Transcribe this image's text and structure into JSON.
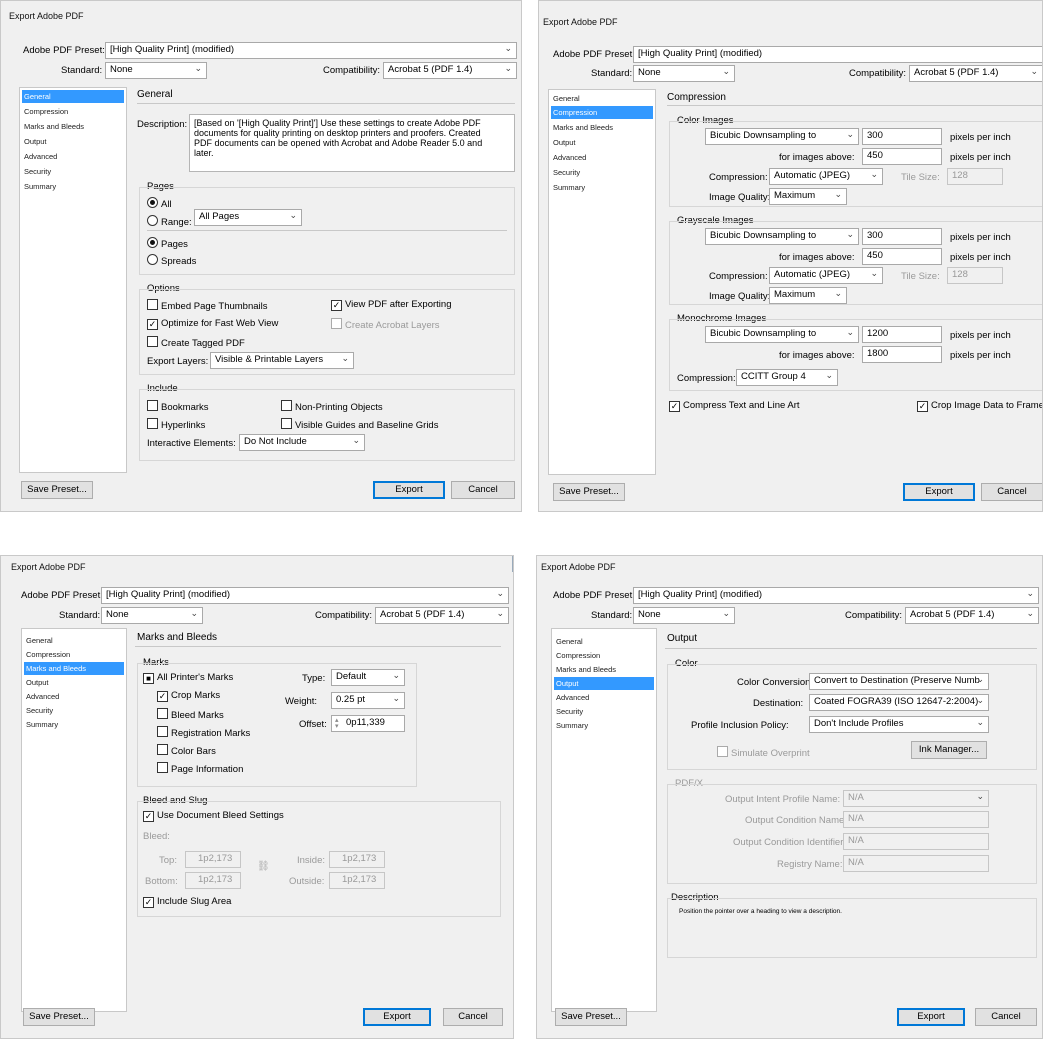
{
  "dialog_title": "Export Adobe PDF",
  "preset_label": "Adobe PDF Preset:",
  "preset_value": "[High Quality Print] (modified)",
  "standard_label": "Standard:",
  "standard_value": "None",
  "compat_label": "Compatibility:",
  "compat_value": "Acrobat 5 (PDF 1.4)",
  "nav": [
    "General",
    "Compression",
    "Marks and Bleeds",
    "Output",
    "Advanced",
    "Security",
    "Summary"
  ],
  "save_preset": "Save Preset...",
  "export": "Export",
  "cancel": "Cancel",
  "general": {
    "heading": "General",
    "description_label": "Description:",
    "description_text": "[Based on '[High Quality Print]'] Use these settings to create Adobe PDF documents for quality printing on desktop printers and proofers. Created PDF documents can be opened with Acrobat and Adobe Reader 5.0 and later.",
    "pages_heading": "Pages",
    "all": "All",
    "range": "Range:",
    "range_value": "All Pages",
    "pages": "Pages",
    "spreads": "Spreads",
    "options_heading": "Options",
    "embed_thumbs": "Embed Page Thumbnails",
    "view_pdf": "View PDF after Exporting",
    "optimize": "Optimize for Fast Web View",
    "create_acrobat_layers": "Create Acrobat Layers",
    "tagged_pdf": "Create Tagged PDF",
    "export_layers_label": "Export Layers:",
    "export_layers_value": "Visible & Printable Layers",
    "include_heading": "Include",
    "bookmarks": "Bookmarks",
    "non_printing": "Non-Printing Objects",
    "hyperlinks": "Hyperlinks",
    "visible_guides": "Visible Guides and Baseline Grids",
    "interactive_label": "Interactive Elements:",
    "interactive_value": "Do Not Include"
  },
  "compression": {
    "heading": "Compression",
    "color_heading": "Color Images",
    "gray_heading": "Grayscale Images",
    "mono_heading": "Monochrome Images",
    "downsampling": "Bicubic Downsampling to",
    "ppi_label": "pixels per inch",
    "above_label": "for images above:",
    "compression_label": "Compression:",
    "jpeg": "Automatic (JPEG)",
    "tile_label": "Tile Size:",
    "tile_value": "128",
    "quality_label": "Image Quality:",
    "quality_value": "Maximum",
    "color_ppi": "300",
    "color_above": "450",
    "gray_ppi": "300",
    "gray_above": "450",
    "mono_ppi": "1200",
    "mono_above": "1800",
    "mono_comp": "CCITT Group 4",
    "compress_text": "Compress Text and Line Art",
    "crop_image": "Crop Image Data to Frames"
  },
  "marks": {
    "heading": "Marks and Bleeds",
    "marks_heading": "Marks",
    "all_printers": "All Printer's Marks",
    "crop": "Crop Marks",
    "bleed": "Bleed Marks",
    "registration": "Registration Marks",
    "color_bars": "Color Bars",
    "page_info": "Page Information",
    "type_label": "Type:",
    "type_value": "Default",
    "weight_label": "Weight:",
    "weight_value": "0.25 pt",
    "offset_label": "Offset:",
    "offset_value": "0p11,339",
    "bleed_slug_heading": "Bleed and Slug",
    "use_doc_bleed": "Use Document Bleed Settings",
    "bleed_label": "Bleed:",
    "top_label": "Top:",
    "bottom_label": "Bottom:",
    "inside_label": "Inside:",
    "outside_label": "Outside:",
    "bleed_value": "1p2,173",
    "include_slug": "Include Slug Area"
  },
  "output": {
    "heading": "Output",
    "color_heading": "Color",
    "conversion_label": "Color Conversion:",
    "conversion_value": "Convert to Destination (Preserve Numb",
    "destination_label": "Destination:",
    "destination_value": "Coated FOGRA39 (ISO 12647-2:2004)",
    "profile_label": "Profile Inclusion Policy:",
    "profile_value": "Don't Include Profiles",
    "simulate": "Simulate Overprint",
    "ink_manager": "Ink Manager...",
    "pdfx_heading": "PDF/X",
    "intent_label": "Output Intent Profile Name:",
    "condition_label": "Output Condition Name:",
    "identifier_label": "Output Condition Identifier:",
    "registry_label": "Registry Name:",
    "na": "N/A",
    "description_heading": "Description",
    "description_text": "Position the pointer over a heading to view a description."
  }
}
